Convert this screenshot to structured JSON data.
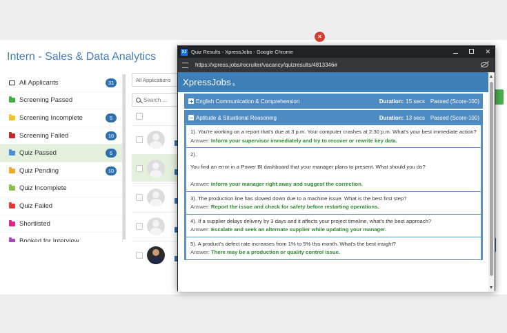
{
  "app": {
    "title": "Intern - Sales & Data Analytics",
    "filter_placeholder": "All Applications",
    "search_placeholder": "Search ..."
  },
  "sidebar": {
    "items": [
      {
        "label": "All Applicants",
        "count": "31",
        "color": "#333333",
        "icon": "inbox-icon"
      },
      {
        "label": "Screening Passed",
        "count": "",
        "color": "#3cb043",
        "icon": "folder-icon"
      },
      {
        "label": "Screening Incomplete",
        "count": "5",
        "color": "#f2c12e",
        "icon": "folder-icon"
      },
      {
        "label": "Screening Failed",
        "count": "10",
        "color": "#c62828",
        "icon": "folder-icon"
      },
      {
        "label": "Quiz Passed",
        "count": "6",
        "color": "#4a90d9",
        "icon": "folder-icon"
      },
      {
        "label": "Quiz Pending",
        "count": "10",
        "color": "#f5a623",
        "icon": "folder-icon"
      },
      {
        "label": "Quiz Incomplete",
        "count": "",
        "color": "#8bc34a",
        "icon": "folder-icon"
      },
      {
        "label": "Quiz Failed",
        "count": "",
        "color": "#e53935",
        "icon": "folder-icon"
      },
      {
        "label": "Shortlisted",
        "count": "",
        "color": "#e91e8c",
        "icon": "folder-icon"
      },
      {
        "label": "Booked for Interview",
        "count": "",
        "color": "#ab47bc",
        "icon": "folder-icon"
      }
    ]
  },
  "popup": {
    "window_title": "Quiz Results - XpressJobs - Google Chrome",
    "app_icon_text": "XJ",
    "url": "https://xpress.jobs/recruiter/vacancy/quizresults/4813346#",
    "brand": "XpressJobs",
    "brand_mark": "®",
    "close_glyph": "×",
    "window_close_glyph": "✕",
    "sections": [
      {
        "name": "English Communication & Comprehension",
        "duration_label": "Duration:",
        "duration": "15 secs",
        "status": "Passed (Score-100)",
        "expanded": false
      },
      {
        "name": "Aptitude & Situational Reasoning",
        "duration_label": "Duration:",
        "duration": "13 secs",
        "status": "Passed (Score-100)",
        "expanded": true
      }
    ],
    "questions": [
      {
        "q": "1). You're working on a report that's due at 3 p.m. Your computer crashes at 2:30 p.m. What's your best immediate action?",
        "answer_label": "Answer:",
        "answer": "Inform your supervisor immediately and try to recover or rewrite key data."
      },
      {
        "q": "2).",
        "q2": "You find an error in a Power BI dashboard that your manager plans to present. What should you do?",
        "answer_label": "Answer:",
        "answer": "Inform your manager right away and suggest the correction."
      },
      {
        "q": "3). The production line has slowed down due to a machine issue. What is the best first step?",
        "answer_label": "Answer:",
        "answer": "Report the issue and check for safety before restarting operations."
      },
      {
        "q": "4). If a supplier delays delivery by 3 days and it affects your project timeline, what's the best approach?",
        "answer_label": "Answer:",
        "answer": "Escalate and seek an alternate supplier while updating your manager."
      },
      {
        "q": "5).  A product's defect rate increases from 1% to 5% this month. What's the best insight?",
        "answer_label": "Answer:",
        "answer": "There may be a production or quality control issue."
      }
    ]
  }
}
